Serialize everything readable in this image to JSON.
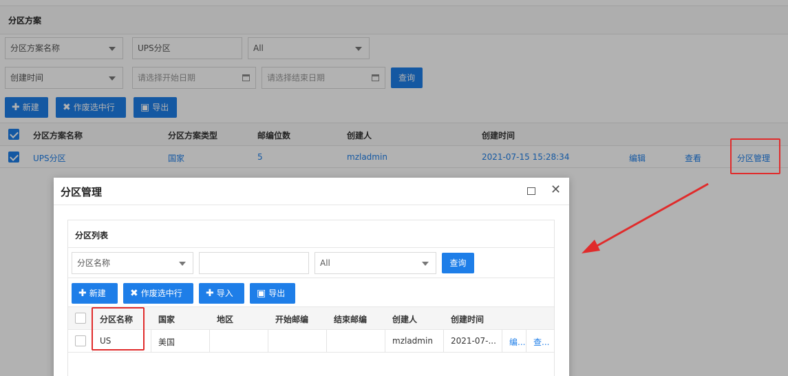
{
  "background": {
    "panel_title": "分区方案",
    "filters": {
      "field_select": "分区方案名称",
      "name_value": "UPS分区",
      "type_select": "All",
      "time_select": "创建时间",
      "start_date_placeholder": "请选择开始日期",
      "end_date_placeholder": "请选择结束日期",
      "query_label": "查询"
    },
    "toolbar": {
      "new_label": "新建",
      "void_label": "作废选中行",
      "export_label": "导出"
    },
    "table": {
      "headers": [
        "分区方案名称",
        "分区方案类型",
        "邮编位数",
        "创建人",
        "创建时间"
      ],
      "row": {
        "name": "UPS分区",
        "type": "国家",
        "digits": "5",
        "creator": "mzladmin",
        "created": "2021-07-15 15:28:34",
        "edit": "编辑",
        "view": "查看",
        "manage": "分区管理"
      }
    }
  },
  "modal": {
    "title": "分区管理",
    "panel_title": "分区列表",
    "filters": {
      "field_select": "分区名称",
      "value": "",
      "type_select": "All",
      "query_label": "查询"
    },
    "toolbar": {
      "new_label": "新建",
      "void_label": "作废选中行",
      "import_label": "导入",
      "export_label": "导出"
    },
    "table": {
      "headers": [
        "分区名称",
        "国家",
        "地区",
        "开始邮编",
        "结束邮编",
        "创建人",
        "创建时间"
      ],
      "row": {
        "name": "US",
        "country": "美国",
        "region": "",
        "start_zip": "",
        "end_zip": "",
        "creator": "mzladmin",
        "created": "2021-07-...",
        "edit": "编...",
        "view": "查..."
      }
    }
  },
  "colors": {
    "accent": "#1e7ee8",
    "annotation": "#e02b2b"
  }
}
